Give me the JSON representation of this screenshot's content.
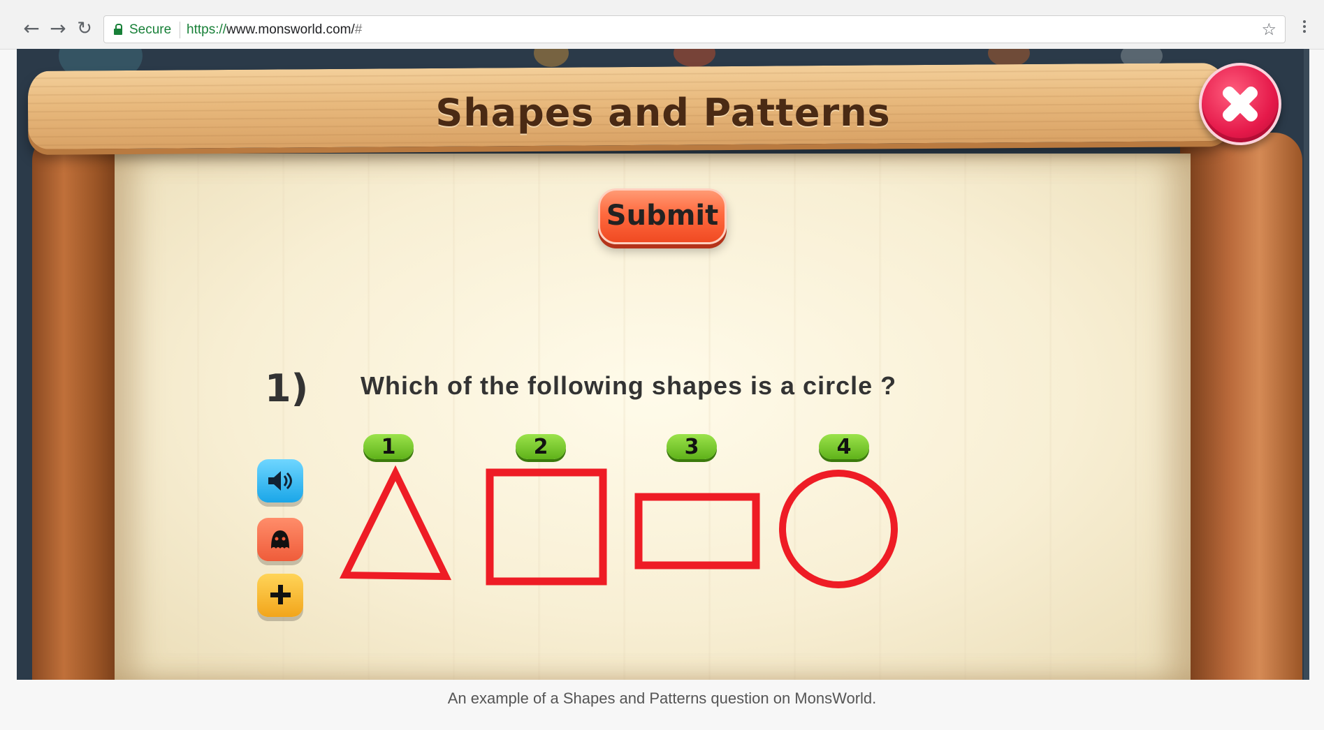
{
  "browser": {
    "back_icon": "arrow-left-icon",
    "forward_icon": "arrow-right-icon",
    "reload_icon": "reload-icon",
    "secure_label": "Secure",
    "url_scheme": "https://",
    "url_host": "www.monsworld.com/",
    "url_hash": "#",
    "bookmark_icon": "star-icon",
    "menu_icon": "more-vertical-icon"
  },
  "game": {
    "title": "Shapes and Patterns",
    "close_icon": "close-icon",
    "submit_label": "Submit",
    "question_number": "1)",
    "question_text": "Which of the following shapes is a circle ?",
    "tools": [
      {
        "name": "speaker-icon"
      },
      {
        "name": "character-hint-icon"
      },
      {
        "name": "plus-icon"
      }
    ],
    "options": [
      {
        "label": "1",
        "shape": "triangle"
      },
      {
        "label": "2",
        "shape": "square"
      },
      {
        "label": "3",
        "shape": "rectangle"
      },
      {
        "label": "4",
        "shape": "circle"
      }
    ],
    "shape_color": "#ee1c25",
    "accent_colors": {
      "submit": "#ff6a3f",
      "close": "#e5194a",
      "badge": "#5fb21a",
      "wood": "#e8b97d"
    }
  },
  "caption": "An example of a Shapes and Patterns question on MonsWorld."
}
